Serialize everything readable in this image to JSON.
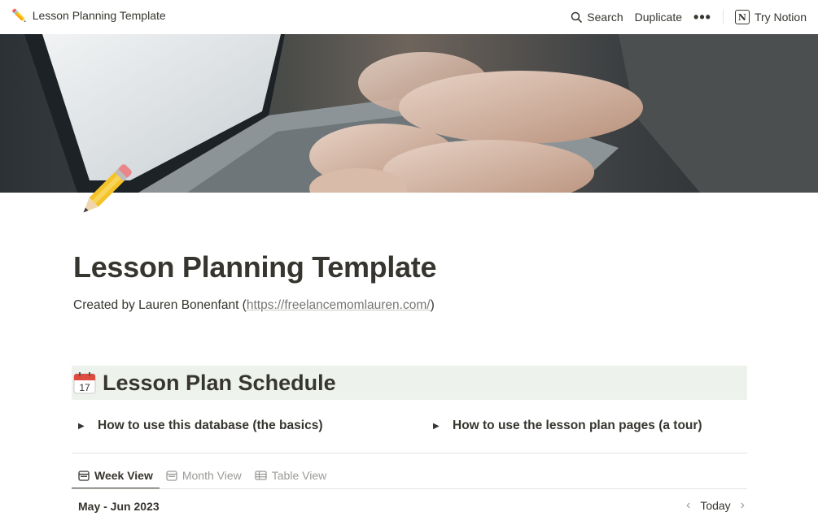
{
  "topbar": {
    "breadcrumb_emoji": "✏️",
    "breadcrumb_title": "Lesson Planning Template",
    "search_label": "Search",
    "duplicate_label": "Duplicate",
    "more_label": "•••",
    "try_notion_label": "Try Notion"
  },
  "page": {
    "title": "Lesson Planning Template",
    "created_by_prefix": "Created by Lauren Bonenfant (",
    "created_by_link": "https://freelancemomlauren.com/",
    "created_by_suffix": ")"
  },
  "schedule": {
    "heading": "Lesson Plan Schedule",
    "calendar_day": "17",
    "toggles": [
      {
        "label": "How to use this database (the basics)"
      },
      {
        "label": "How to use the lesson plan pages (a tour)"
      }
    ],
    "tabs": [
      {
        "label": "Week View",
        "active": true
      },
      {
        "label": "Month View",
        "active": false
      },
      {
        "label": "Table View",
        "active": false
      }
    ],
    "range_label": "May - Jun 2023",
    "today_label": "Today"
  },
  "colors": {
    "text": "#37352f",
    "muted": "#9b9a97",
    "heading_bg": "#edf3ec"
  }
}
